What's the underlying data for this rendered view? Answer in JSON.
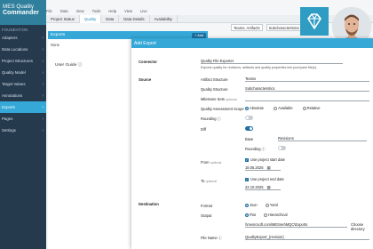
{
  "app": {
    "brand_line1": "MES Quality",
    "brand_line2": "Commander",
    "section": "FOUNDATION",
    "sidebar": [
      {
        "label": "Adapters"
      },
      {
        "label": "Data Locations"
      },
      {
        "label": "Project Structures"
      },
      {
        "label": "Quality Model"
      },
      {
        "label": "Target Values"
      },
      {
        "label": "Annotations"
      },
      {
        "label": "Exports",
        "active": true
      },
      {
        "label": "Pages"
      },
      {
        "label": "Settings"
      }
    ]
  },
  "menu": [
    "File",
    "Data",
    "View",
    "Tools",
    "Help",
    "View",
    "Live"
  ],
  "tabs": [
    {
      "label": "Project Status"
    },
    {
      "label": "Quality",
      "active": true
    },
    {
      "label": "Data"
    },
    {
      "label": "Data Details"
    },
    {
      "label": "Availability"
    }
  ],
  "exports": {
    "title": "Exports",
    "add_label": "+ Add",
    "empty_text": "None",
    "user_guide": "User Guide ⓘ"
  },
  "background_fields": [
    "Teams, Artifacts",
    "Subcharacteristics"
  ],
  "dialog": {
    "title": "Add Export",
    "connector": {
      "section": "Connector",
      "value": "Quality File Exporter",
      "help": "Exports quality for revisions, artifacts and quality properties into json/yaml file(s)."
    },
    "source": {
      "section": "Source",
      "artifact_structure_label": "Artifact Structure",
      "artifact_structure_value": "Teams",
      "quality_structure_label": "Quality Structure",
      "quality_structure_value": "Subcharacteristics",
      "milestone_sets_label": "Milestone Sets",
      "milestone_sets_optional": "optional",
      "milestone_sets_value": "",
      "qa_scope_label": "Quality Assessment Scope",
      "qa_scope_options": [
        "Absolute",
        "Available",
        "Relative"
      ],
      "qa_scope_selected": "Absolute",
      "rounding_label": "Rounding ⓘ",
      "rounding_on": false,
      "diff_label": "Diff",
      "diff_on": true,
      "base_label": "Base",
      "base_value": "Revisions",
      "diff_rounding_label": "Rounding ⓘ",
      "diff_rounding_on": false,
      "from_label": "From",
      "from_optional": "optional",
      "from_check": "Use project start date",
      "from_date": "18.05.2025",
      "to_label": "To",
      "to_optional": "optional",
      "to_check": "Use project end date",
      "to_date": "22.10.2025"
    },
    "destination": {
      "section": "Destination",
      "format_label": "Format",
      "format_options": [
        "Json",
        "Yaml"
      ],
      "format_selected": "Json",
      "output_label": "Output",
      "output_options": [
        "Flat",
        "Hierarchical"
      ],
      "output_selected": "Flat",
      "path_value": "\\\\mesrcsoft.com\\MESnet\\MQC\\Exports",
      "choose_label": "Choose directory",
      "file_name_label": "File Name ⓘ",
      "file_name_value": "QualityExport_{revision}"
    }
  }
}
